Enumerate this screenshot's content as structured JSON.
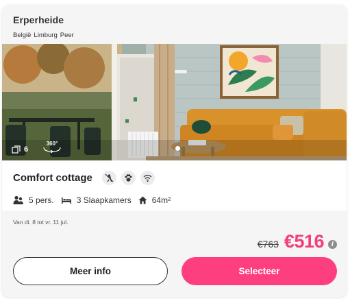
{
  "park": {
    "name": "Erperheide",
    "location": [
      "België",
      "Limburg",
      "Peer"
    ]
  },
  "photo": {
    "image_count": "6",
    "view_360_label": "360°",
    "content": "living-room-photo"
  },
  "accommodation": {
    "title": "Comfort cottage",
    "amenities": [
      "no-smoking-icon",
      "paw-pet-icon",
      "wifi-icon"
    ],
    "specs": {
      "persons": "5 pers.",
      "bedrooms": "3 Slaapkamers",
      "area": "64m²"
    }
  },
  "booking": {
    "dates": "Van di. 8 tot vr. 11 jul.",
    "old_price": "€763",
    "new_price": "€516",
    "info_symbol": "i"
  },
  "buttons": {
    "more_info": "Meer info",
    "select": "Selecteer"
  },
  "colors": {
    "accent": "#fe3f7f",
    "price": "#f33d7f",
    "sofa": "#d9922b"
  }
}
